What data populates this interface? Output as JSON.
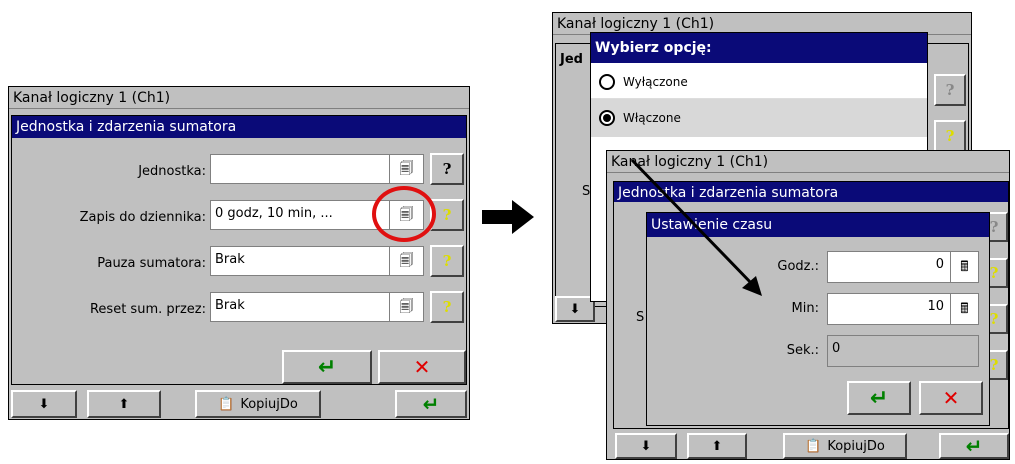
{
  "left_window": {
    "title": "Kanał logiczny 1 (Ch1)",
    "dialog_title": "Jednostka i zdarzenia sumatora",
    "fields": [
      {
        "label": "Jednostka:",
        "value": ""
      },
      {
        "label": "Zapis do dziennika:",
        "value": "0 godz, 10 min, ..."
      },
      {
        "label": "Pauza sumatora:",
        "value": "Brak"
      },
      {
        "label": "Reset sum. przez:",
        "value": "Brak"
      }
    ],
    "ok_glyph": "↵",
    "cancel_glyph": "✕",
    "toolbar": {
      "copy_label": "KopiujDo",
      "enter_glyph": "↵"
    }
  },
  "back_window": {
    "title": "Kanał logiczny 1 (Ch1)",
    "partial_label": "Jed",
    "partial_s": "S"
  },
  "option_dialog": {
    "title": "Wybierz opcję:",
    "options": [
      {
        "label": "Wyłączone",
        "selected": false
      },
      {
        "label": "Włączone",
        "selected": true
      }
    ]
  },
  "front_window": {
    "title": "Kanał logiczny 1 (Ch1)",
    "dialog_title": "Jednostka i zdarzenia sumatora",
    "partial_s": "S",
    "toolbar": {
      "copy_label": "KopiujDo",
      "enter_glyph": "↵"
    }
  },
  "time_dialog": {
    "title": "Ustawienie czasu",
    "fields": [
      {
        "label": "Godz.:",
        "value": "0"
      },
      {
        "label": "Min:",
        "value": "10"
      },
      {
        "label": "Sek.:",
        "value": "0"
      }
    ],
    "ok_glyph": "↵",
    "cancel_glyph": "✕"
  },
  "colors": {
    "navy": "#0a0a78",
    "ok_green": "#008000",
    "cancel_red": "#e00000",
    "highlight_circle": "#e01010",
    "question_yellow": "#ffff00"
  },
  "icons": [
    "properties-icon",
    "help-icon",
    "calculator-icon",
    "scroll-down-icon",
    "scroll-up-icon",
    "copy-icon",
    "arrow-right-icon"
  ]
}
